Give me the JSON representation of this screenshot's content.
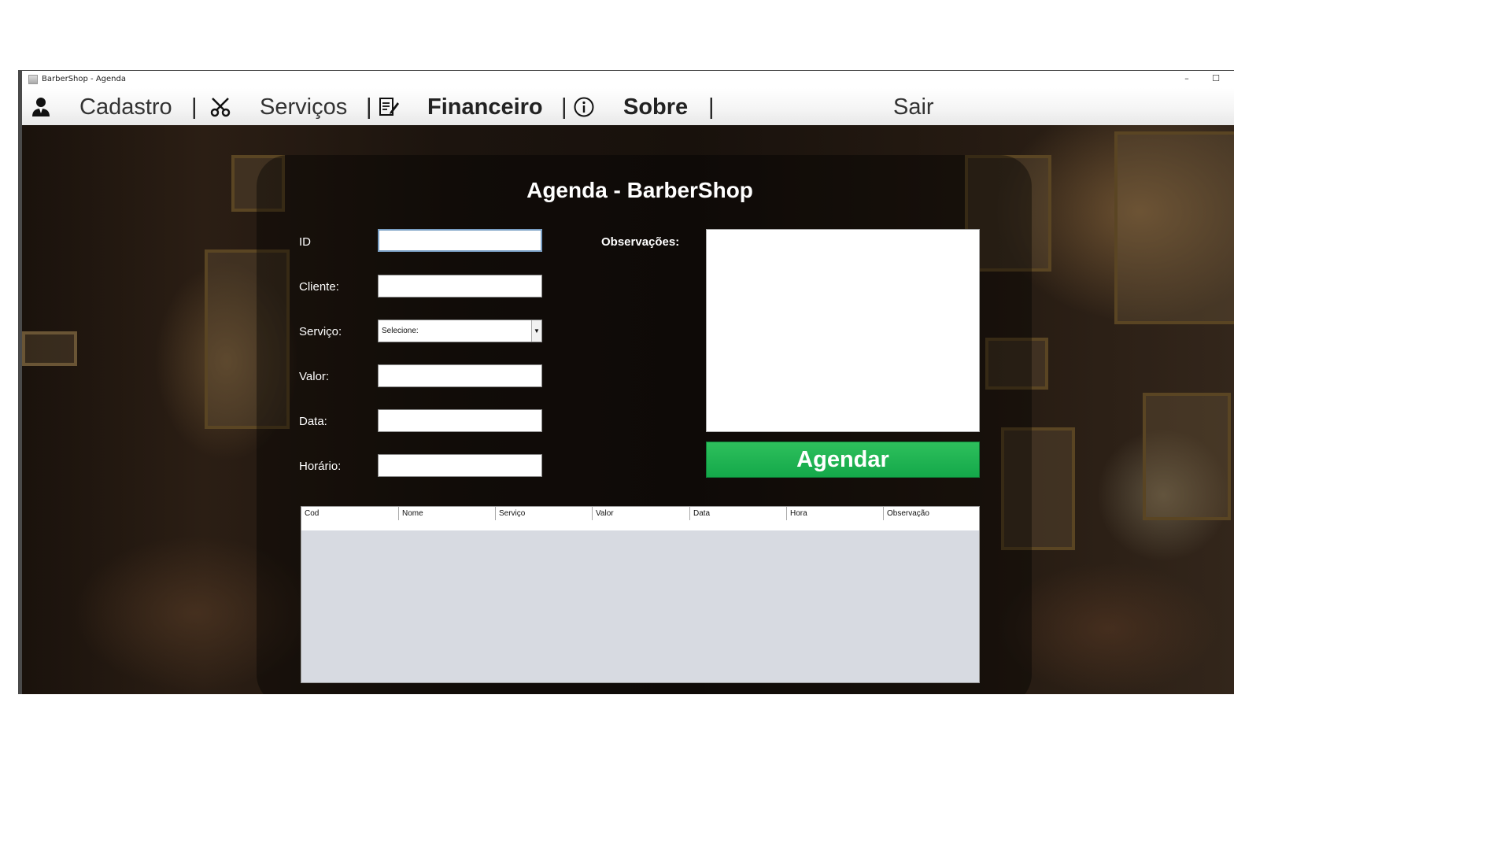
{
  "window": {
    "title": "BarberShop - Agenda",
    "minimize": "–",
    "maximize": "☐"
  },
  "menu": {
    "cadastro": "Cadastro",
    "servicos": "Serviços",
    "financeiro": "Financeiro",
    "sobre": "Sobre",
    "sair": "Sair",
    "separator": "|",
    "icons": [
      "user-icon",
      "scissors-icon",
      "edit-document-icon",
      "info-icon"
    ]
  },
  "form": {
    "heading": "Agenda - BarberShop",
    "labels": {
      "id": "ID",
      "cliente": "Cliente:",
      "servico": "Serviço:",
      "valor": "Valor:",
      "data": "Data:",
      "horario": "Horário:",
      "observacoes": "Observações:"
    },
    "values": {
      "id": "",
      "cliente": "",
      "valor": "",
      "data": "",
      "horario": "",
      "observacoes": ""
    },
    "servico_selected": "Selecione:",
    "submit_label": "Agendar",
    "accent_color": "#14a84a"
  },
  "table": {
    "columns": [
      "Cod",
      "Nome",
      "Serviço",
      "Valor",
      "Data",
      "Hora",
      "Observação"
    ],
    "rows": []
  }
}
